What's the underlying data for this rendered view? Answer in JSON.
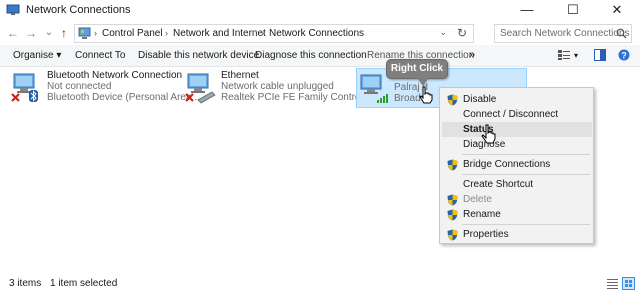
{
  "window": {
    "title": "Network Connections",
    "minimize_glyph": "—",
    "maximize_glyph": "☐",
    "close_glyph": "✕"
  },
  "navigation": {
    "back_glyph": "←",
    "forward_glyph": "→",
    "recent_glyph": "⌄",
    "up_glyph": "↑"
  },
  "address": {
    "crumbs": [
      "Control Panel",
      "Network and Internet",
      "Network Connections"
    ],
    "separator": "›",
    "dropdown_glyph": "⌄",
    "refresh_glyph": "↻"
  },
  "search": {
    "placeholder": "Search Network Connections"
  },
  "commandbar": {
    "organise": "Organise ▾",
    "connect_to": "Connect To",
    "disable_device": "Disable this network device",
    "diagnose": "Diagnose this connection",
    "rename": "Rename this connection",
    "more": "»"
  },
  "connections": [
    {
      "name": "Bluetooth Network Connection",
      "status": "Not connected",
      "device": "Bluetooth Device (Personal Area ..."
    },
    {
      "name": "Ethernet",
      "status": "Network cable unplugged",
      "device": "Realtek PCIe FE Family Controller"
    },
    {
      "name": "",
      "status": "Palraj d",
      "device": "Broadc"
    }
  ],
  "callout": {
    "text": "Right Click"
  },
  "context_menu": {
    "items": [
      {
        "label": "Disable",
        "shield": true
      },
      {
        "label": "Connect / Disconnect",
        "shield": false
      },
      {
        "label": "Status",
        "shield": false
      },
      {
        "label": "Diagnose",
        "shield": false
      },
      {
        "label": "Bridge Connections",
        "shield": true
      },
      {
        "label": "Create Shortcut",
        "shield": false
      },
      {
        "label": "Delete",
        "shield": true
      },
      {
        "label": "Rename",
        "shield": true
      },
      {
        "label": "Properties",
        "shield": true
      }
    ]
  },
  "status": {
    "item_count": "3 items",
    "selection": "1 item selected"
  },
  "colors": {
    "selection_bg": "#cce8ff",
    "menu_bg": "#f2f2f2",
    "shield_blue": "#2b5fb4",
    "shield_yellow": "#f2c200",
    "error_red": "#d9201c",
    "signal_green": "#2e9e2e"
  }
}
